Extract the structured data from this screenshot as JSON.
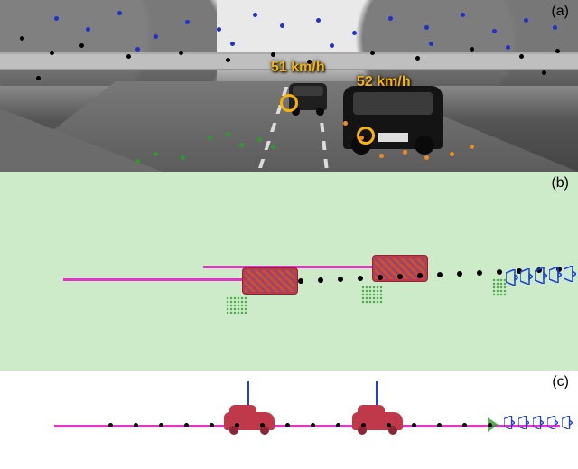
{
  "panels": {
    "a": {
      "label": "(a)"
    },
    "b": {
      "label": "(b)"
    },
    "c": {
      "label": "(c)"
    }
  },
  "scene": {
    "speed1": "51 km/h",
    "speed2": "52 km/h"
  },
  "colors": {
    "speed_text": "#f7b500",
    "trajectory": "#e236c6",
    "vehicle_box": "#c0394a",
    "camera_outline": "#1b3fe0",
    "ground_points": "#2e9b2e",
    "topdown_bg": "#cdebc8"
  },
  "feature_points": {
    "panel_a": {
      "blue": [
        [
          60,
          18
        ],
        [
          95,
          30
        ],
        [
          130,
          12
        ],
        [
          170,
          38
        ],
        [
          205,
          22
        ],
        [
          240,
          30
        ],
        [
          280,
          14
        ],
        [
          310,
          26
        ],
        [
          350,
          20
        ],
        [
          390,
          34
        ],
        [
          430,
          18
        ],
        [
          470,
          28
        ],
        [
          510,
          14
        ],
        [
          545,
          32
        ],
        [
          580,
          20
        ],
        [
          612,
          28
        ],
        [
          150,
          52
        ],
        [
          255,
          46
        ],
        [
          365,
          48
        ],
        [
          475,
          46
        ],
        [
          560,
          50
        ]
      ],
      "black": [
        [
          22,
          40
        ],
        [
          55,
          56
        ],
        [
          88,
          48
        ],
        [
          140,
          60
        ],
        [
          198,
          56
        ],
        [
          250,
          64
        ],
        [
          300,
          58
        ],
        [
          340,
          66
        ],
        [
          410,
          56
        ],
        [
          460,
          62
        ],
        [
          520,
          52
        ],
        [
          575,
          60
        ],
        [
          615,
          54
        ],
        [
          40,
          84
        ],
        [
          600,
          78
        ]
      ],
      "green": [
        [
          230,
          150
        ],
        [
          250,
          146
        ],
        [
          265,
          158
        ],
        [
          285,
          152
        ],
        [
          300,
          160
        ],
        [
          170,
          168
        ],
        [
          200,
          172
        ],
        [
          150,
          176
        ]
      ],
      "orange": [
        [
          420,
          170
        ],
        [
          446,
          166
        ],
        [
          470,
          172
        ],
        [
          398,
          150
        ],
        [
          380,
          134
        ],
        [
          498,
          168
        ],
        [
          520,
          160
        ]
      ]
    }
  },
  "chart_data": [
    {
      "type": "scatter",
      "title": "(a) Camera view with tracked feature points and estimated vehicle speeds",
      "series": [
        {
          "name": "static background features (blue)",
          "color": "#2030c8"
        },
        {
          "name": "static background features (black)",
          "color": "#000000"
        },
        {
          "name": "ground-plane features (green)",
          "color": "#2e9b2e"
        },
        {
          "name": "moving-vehicle features (orange)",
          "color": "#f08a24"
        }
      ],
      "annotations": [
        {
          "text": "51 km/h",
          "target": "left vehicle"
        },
        {
          "text": "52 km/h",
          "target": "right vehicle"
        }
      ]
    },
    {
      "type": "scatter",
      "title": "(b) Top-down (bird's-eye) reconstruction",
      "series": [
        {
          "name": "ego trajectory / camera poses",
          "color": "#000000"
        },
        {
          "name": "tracked vehicle bounding boxes",
          "color": "#c0394a"
        },
        {
          "name": "vehicle trajectories",
          "color": "#e236c6"
        },
        {
          "name": "ground 3D points",
          "color": "#2e9b2e"
        },
        {
          "name": "camera frustums",
          "color": "#1b3fe0"
        }
      ]
    },
    {
      "type": "scatter",
      "title": "(c) Side-view reconstruction",
      "series": [
        {
          "name": "ground line / vehicle trajectories",
          "color": "#e236c6"
        },
        {
          "name": "vehicle vertical extent",
          "color": "#1b3fe0"
        },
        {
          "name": "ego trajectory / camera poses",
          "color": "#000000"
        },
        {
          "name": "tracked vehicles",
          "color": "#c0394a"
        }
      ]
    }
  ]
}
